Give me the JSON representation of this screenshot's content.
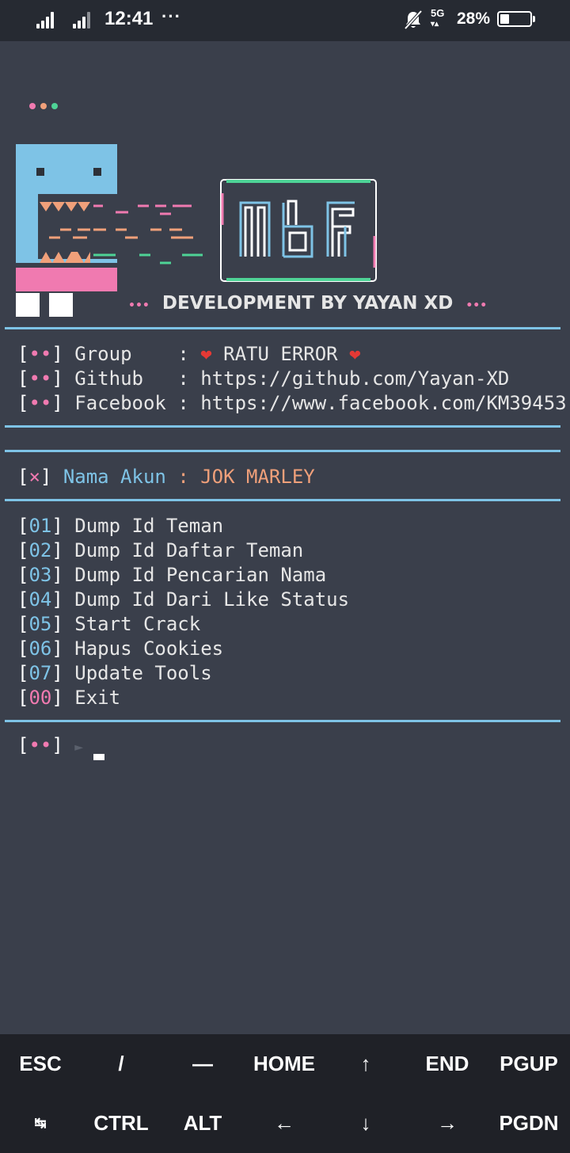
{
  "status_bar": {
    "time": "12:41",
    "overflow": "···",
    "network": "5G",
    "battery_percent": "28%",
    "battery_level": 0.28,
    "icons": [
      "signal-icon",
      "signal-icon",
      "bell-muted-icon",
      "battery-icon"
    ]
  },
  "banner": {
    "dots_top": "•••",
    "logo_text": "MBF",
    "dev_dots_left": "•••",
    "dev_text": "DEVELOPMENT BY YAYAN XD",
    "dev_dots_right": "•••"
  },
  "info": [
    {
      "bracket_dots": "••",
      "label": "Group   ",
      "sep": ":",
      "value": "RATU ERROR",
      "heart": "❤"
    },
    {
      "bracket_dots": "••",
      "label": "Github  ",
      "sep": ":",
      "value": "https://github.com/Yayan-XD"
    },
    {
      "bracket_dots": "••",
      "label": "Facebook",
      "sep": ":",
      "value": "https://www.facebook.com/KM39453"
    }
  ],
  "account": {
    "mark": "×",
    "label": "Nama Akun",
    "sep": ":",
    "name": "JOK MARLEY"
  },
  "menu": [
    {
      "num": "01",
      "label": "Dump Id Teman"
    },
    {
      "num": "02",
      "label": "Dump Id Daftar Teman"
    },
    {
      "num": "03",
      "label": "Dump Id Pencarian Nama"
    },
    {
      "num": "04",
      "label": "Dump Id Dari Like Status"
    },
    {
      "num": "05",
      "label": "Start Crack"
    },
    {
      "num": "06",
      "label": "Hapus Cookies"
    },
    {
      "num": "07",
      "label": "Update Tools"
    },
    {
      "num": "00",
      "label": "Exit"
    }
  ],
  "prompt": {
    "bracket_dots": "••",
    "arrow": "►"
  },
  "extra_keys": {
    "row1": [
      "ESC",
      "/",
      "—",
      "HOME",
      "↑",
      "END",
      "PGUP"
    ],
    "row2": [
      "↹",
      "CTRL",
      "ALT",
      "←",
      "↓",
      "→",
      "PGDN"
    ]
  },
  "colors": {
    "background": "#3a3f4b",
    "accent_blue": "#7ec3e6",
    "accent_pink": "#f07ab0",
    "accent_green": "#4ed396",
    "accent_orange": "#f0a07a"
  }
}
